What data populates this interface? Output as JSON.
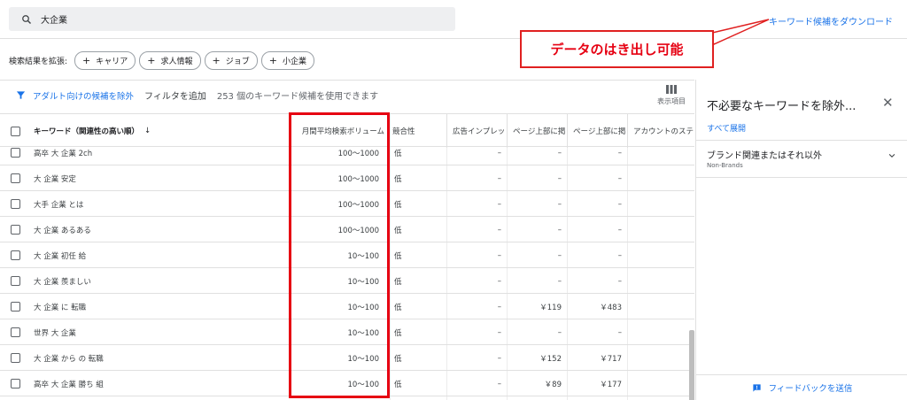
{
  "search": {
    "query": "大企業"
  },
  "download_link": "キーワード候補をダウンロード",
  "callout": "データのはき出し可能",
  "expand": {
    "label": "検索結果を拡張:",
    "chips": [
      "キャリア",
      "求人情報",
      "ジョブ",
      "小企業"
    ]
  },
  "filter_bar": {
    "exclude_adult": "アダルト向けの候補を除外",
    "add_filter": "フィルタを追加",
    "count_text": "253 個のキーワード候補を使用できます",
    "columns_label": "表示項目"
  },
  "table": {
    "headers": {
      "keyword": "キーワード（関連性の高い順）",
      "volume": "月間平均検索ボリューム",
      "competition": "競合性",
      "impression_share": "広告インプレッ",
      "top_bid_low": "ページ上部に掲",
      "top_bid_high": "ページ上部に掲",
      "account_status": "アカウントのステ"
    },
    "rows": [
      {
        "keyword": "高卒 大 企業 2ch",
        "volume": "100～1000",
        "competition": "低",
        "impression_share": "–",
        "bid_low": "–",
        "bid_high": "–"
      },
      {
        "keyword": "大 企業 安定",
        "volume": "100～1000",
        "competition": "低",
        "impression_share": "–",
        "bid_low": "–",
        "bid_high": "–"
      },
      {
        "keyword": "大手 企業 とは",
        "volume": "100～1000",
        "competition": "低",
        "impression_share": "–",
        "bid_low": "–",
        "bid_high": "–"
      },
      {
        "keyword": "大 企業 あるある",
        "volume": "100～1000",
        "competition": "低",
        "impression_share": "–",
        "bid_low": "–",
        "bid_high": "–"
      },
      {
        "keyword": "大 企業 初任 給",
        "volume": "10～100",
        "competition": "低",
        "impression_share": "–",
        "bid_low": "–",
        "bid_high": "–"
      },
      {
        "keyword": "大 企業 羨ましい",
        "volume": "10～100",
        "competition": "低",
        "impression_share": "–",
        "bid_low": "–",
        "bid_high": "–"
      },
      {
        "keyword": "大 企業 に 転職",
        "volume": "10～100",
        "competition": "低",
        "impression_share": "–",
        "bid_low": "￥119",
        "bid_high": "￥483"
      },
      {
        "keyword": "世界 大 企業",
        "volume": "10～100",
        "competition": "低",
        "impression_share": "–",
        "bid_low": "–",
        "bid_high": "–"
      },
      {
        "keyword": "大 企業 から の 転職",
        "volume": "10～100",
        "competition": "低",
        "impression_share": "–",
        "bid_low": "￥152",
        "bid_high": "￥717"
      },
      {
        "keyword": "高卒 大 企業 勝ち 組",
        "volume": "10～100",
        "competition": "低",
        "impression_share": "–",
        "bid_low": "￥89",
        "bid_high": "￥177"
      }
    ]
  },
  "panel": {
    "title": "不必要なキーワードを除外...",
    "close": "✕",
    "expand_all": "すべて展開",
    "brand_title": "ブランド関連またはそれ以外",
    "brand_sub": "Non-Brands",
    "feedback": "フィードバックを送信"
  }
}
